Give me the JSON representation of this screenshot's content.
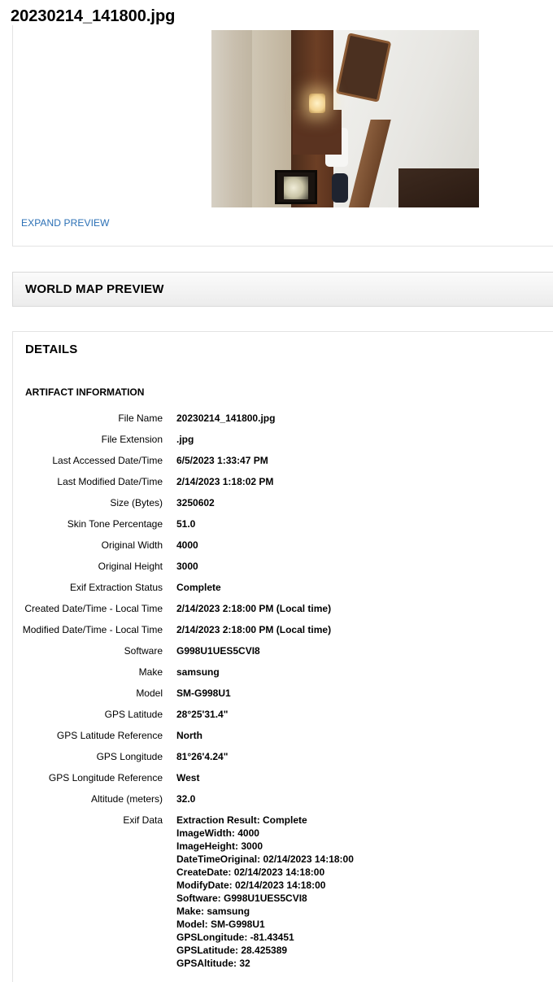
{
  "page": {
    "title": "20230214_141800.jpg"
  },
  "preview": {
    "expand_label": "EXPAND PREVIEW"
  },
  "map": {
    "heading": "WORLD MAP PREVIEW"
  },
  "details": {
    "heading": "DETAILS",
    "section_title": "ARTIFACT INFORMATION",
    "rows": [
      {
        "label": "File Name",
        "value": "20230214_141800.jpg"
      },
      {
        "label": "File Extension",
        "value": ".jpg"
      },
      {
        "label": "Last Accessed Date/Time",
        "value": "6/5/2023 1:33:47 PM"
      },
      {
        "label": "Last Modified Date/Time",
        "value": "2/14/2023 1:18:02 PM"
      },
      {
        "label": "Size (Bytes)",
        "value": "3250602"
      },
      {
        "label": "Skin Tone Percentage",
        "value": "51.0"
      },
      {
        "label": "Original Width",
        "value": "4000"
      },
      {
        "label": "Original Height",
        "value": "3000"
      },
      {
        "label": "Exif Extraction Status",
        "value": "Complete"
      },
      {
        "label": "Created Date/Time - Local Time",
        "value": "2/14/2023 2:18:00 PM (Local time)"
      },
      {
        "label": "Modified Date/Time - Local Time",
        "value": "2/14/2023 2:18:00 PM (Local time)"
      },
      {
        "label": "Software",
        "value": "G998U1UES5CVI8"
      },
      {
        "label": "Make",
        "value": "samsung"
      },
      {
        "label": "Model",
        "value": "SM-G998U1"
      },
      {
        "label": "GPS Latitude",
        "value": "28°25'31.4\""
      },
      {
        "label": "GPS Latitude Reference",
        "value": "North"
      },
      {
        "label": "GPS Longitude",
        "value": "81°26'4.24\""
      },
      {
        "label": "GPS Longitude Reference",
        "value": "West"
      },
      {
        "label": "Altitude (meters)",
        "value": "32.0"
      }
    ],
    "exif": {
      "label": "Exif Data",
      "lines": [
        "Extraction Result: Complete",
        "ImageWidth: 4000",
        "ImageHeight: 3000",
        "DateTimeOriginal: 02/14/2023 14:18:00",
        "CreateDate: 02/14/2023 14:18:00",
        "ModifyDate: 02/14/2023 14:18:00",
        "Software: G998U1UES5CVI8",
        "Make: samsung",
        "Model: SM-G998U1",
        "GPSLongitude: -81.43451",
        "GPSLatitude: 28.425389",
        "GPSAltitude: 32"
      ]
    }
  }
}
